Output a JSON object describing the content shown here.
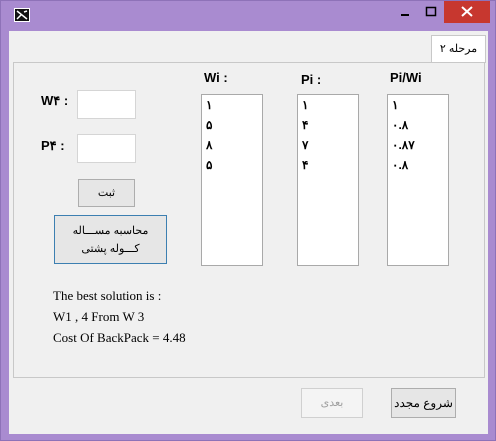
{
  "window": {
    "title": ""
  },
  "tab": {
    "label": "مرحله ۲"
  },
  "inputs": {
    "w_label": "W۴ :",
    "p_label": "P۴ :",
    "w_value": "",
    "p_value": ""
  },
  "buttons": {
    "register": "ثبت",
    "compute_line1": "محاسبه مســـاله",
    "compute_line2": "کـــوله پشتی",
    "next": "بعدی",
    "restart": "شروع مجدد"
  },
  "columns": {
    "wi": {
      "header": "Wi :",
      "items": [
        "۱",
        "۵",
        "۸",
        "۵"
      ]
    },
    "pi": {
      "header": "Pi :",
      "items": [
        "۱",
        "۴",
        "۷",
        "۴"
      ]
    },
    "ratio": {
      "header": "Pi/Wi",
      "items": [
        "۱",
        "۰.۸",
        "۰.۸۷",
        "۰.۸"
      ]
    }
  },
  "result": {
    "line1": "The best solution is :",
    "line2": "W1 , 4 From W 3",
    "line3": "Cost Of BackPack = 4.48"
  },
  "colors": {
    "frame": "#a98bd0",
    "close": "#c7372f",
    "accent_border": "#3c7fb1"
  }
}
